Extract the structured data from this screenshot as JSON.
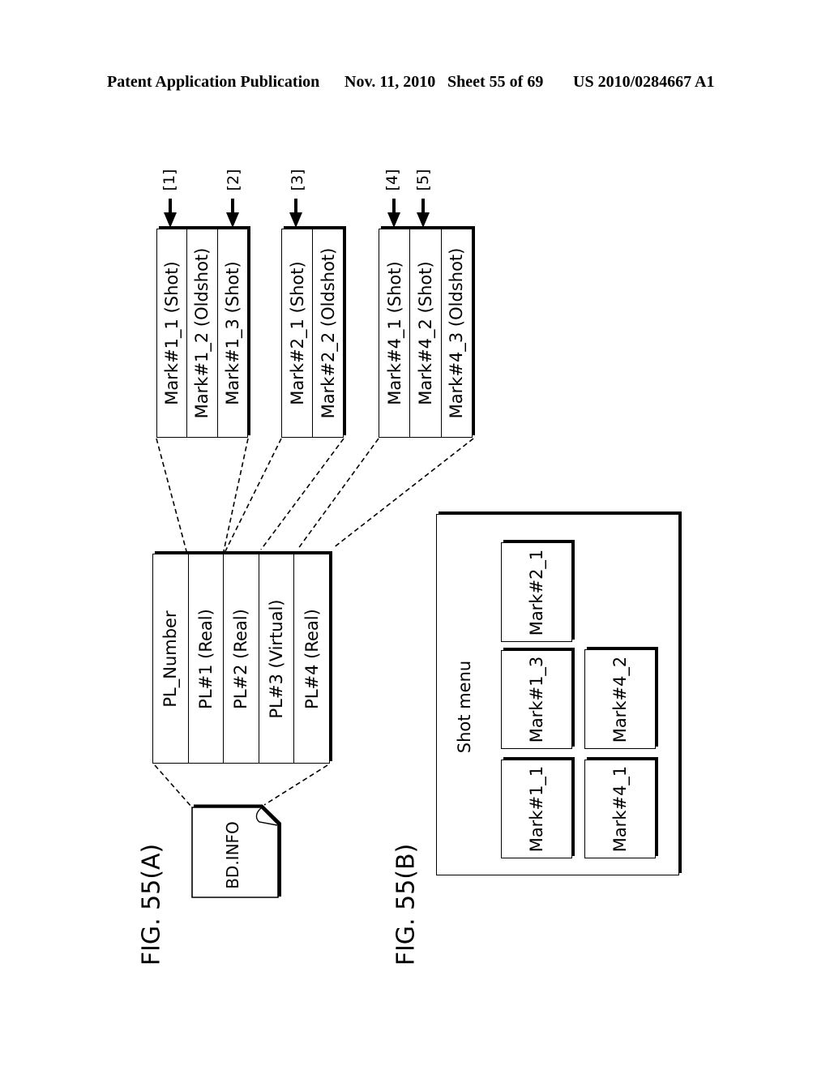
{
  "header": {
    "publication": "Patent Application Publication",
    "date": "Nov. 11, 2010",
    "sheet": "Sheet 55 of 69",
    "number": "US 2010/0284667 A1"
  },
  "figure_a": {
    "label": "FIG. 55(A)",
    "file": "BD.INFO",
    "playlist_table": [
      "PL_Number",
      "PL#1 (Real)",
      "PL#2 (Real)",
      "PL#3 (Virtual)",
      "PL#4 (Real)"
    ],
    "mark_tables": [
      {
        "cells": [
          "Mark#1_1 (Shot)",
          "Mark#1_2 (Oldshot)",
          "Mark#1_3 (Shot)"
        ]
      },
      {
        "cells": [
          "Mark#2_1 (Shot)",
          "Mark#2_2 (Oldshot)"
        ]
      },
      {
        "cells": [
          "Mark#4_1 (Shot)",
          "Mark#4_2 (Shot)",
          "Mark#4_3 (Oldshot)"
        ]
      }
    ],
    "pointers": [
      "[1]",
      "[2]",
      "[3]",
      "[4]",
      "[5]"
    ]
  },
  "figure_b": {
    "label": "FIG. 55(B)",
    "menu_title": "Shot menu",
    "thumbnails": [
      "Mark#2_1",
      "Mark#1_3",
      "Mark#1_1",
      "Mark#4_2",
      "Mark#4_1"
    ]
  }
}
